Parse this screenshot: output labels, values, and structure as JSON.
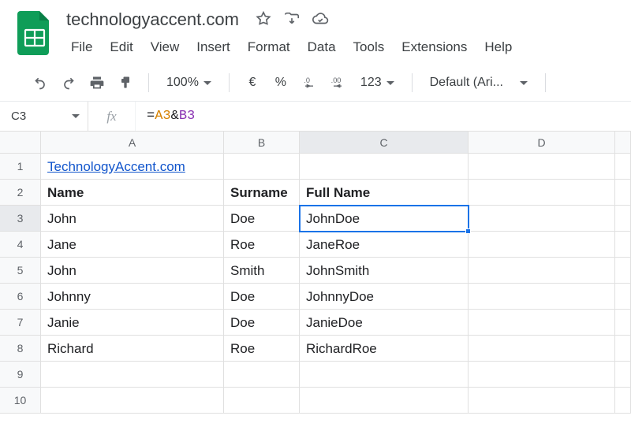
{
  "doc": {
    "title": "technologyaccent.com"
  },
  "menu": {
    "file": "File",
    "edit": "Edit",
    "view": "View",
    "insert": "Insert",
    "format": "Format",
    "data": "Data",
    "tools": "Tools",
    "extensions": "Extensions",
    "help": "Help"
  },
  "toolbar": {
    "zoom": "100%",
    "currency": "€",
    "percent": "%",
    "dec_dec": ".0",
    "inc_dec": ".00",
    "more_formats": "123",
    "font": "Default (Ari..."
  },
  "name_box": "C3",
  "fx_label": "fx",
  "formula": {
    "eq": "=",
    "ref_a": "A3",
    "amp": "&",
    "ref_b": "B3"
  },
  "columns": [
    "A",
    "B",
    "C",
    "D",
    ""
  ],
  "active_col_index": 2,
  "rows": [
    {
      "num": "1",
      "a": "TechnologyAccent.com",
      "b": "",
      "c": "",
      "d": "",
      "a_link": true
    },
    {
      "num": "2",
      "a": "Name",
      "b": "Surname",
      "c": "Full Name",
      "d": "",
      "bold": true
    },
    {
      "num": "3",
      "a": "John",
      "b": "Doe",
      "c": "JohnDoe",
      "d": "",
      "selected_col": "c"
    },
    {
      "num": "4",
      "a": "Jane",
      "b": "Roe",
      "c": "JaneRoe",
      "d": ""
    },
    {
      "num": "5",
      "a": "John",
      "b": "Smith",
      "c": "JohnSmith",
      "d": ""
    },
    {
      "num": "6",
      "a": "Johnny",
      "b": "Doe",
      "c": "JohnnyDoe",
      "d": ""
    },
    {
      "num": "7",
      "a": "Janie",
      "b": "Doe",
      "c": "JanieDoe",
      "d": ""
    },
    {
      "num": "8",
      "a": "Richard",
      "b": "Roe",
      "c": "RichardRoe",
      "d": ""
    },
    {
      "num": "9",
      "a": "",
      "b": "",
      "c": "",
      "d": ""
    },
    {
      "num": "10",
      "a": "",
      "b": "",
      "c": "",
      "d": ""
    }
  ],
  "active_row_index": 2
}
